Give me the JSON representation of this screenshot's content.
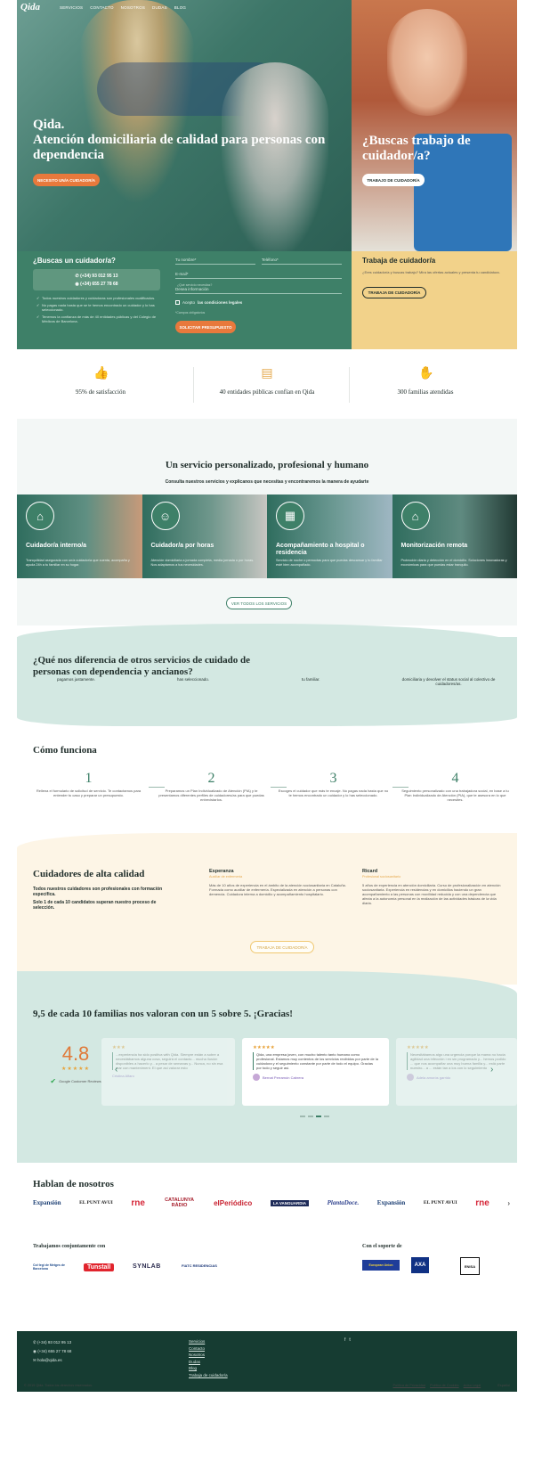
{
  "nav": {
    "logo": "Qida",
    "items": [
      "SERVICIOS",
      "CONTACTO",
      "NOSOTROS",
      "DUDAS",
      "BLOG"
    ]
  },
  "hero": {
    "title_line1": "Qida.",
    "title_line2": "Atención domiciliaria de calidad para personas con dependencia",
    "cta": "NECESITO UN/A CUIDADOR/A",
    "right_title": "¿Buscas trabajo de cuidador/a?",
    "right_cta": "TRABAJO DE CUIDADOR/A"
  },
  "form": {
    "heading": "¿Buscas un cuidador/a?",
    "phone1": "(+34) 93 012 95 13",
    "phone2": "(+34) 655 27 78 68",
    "checks": [
      "Todos nuestros cuidadores y cuidadoras son profesionales cualificados.",
      "No pagas nada hasta que se te hemos encontrado un cuidador y lo has seleccionado.",
      "Tenemos la confianza de más de 40 entidades públicas y del Colegio de Médicos de Barcelona."
    ],
    "name_placeholder": "Tu nombre*",
    "phone_placeholder": "Teléfono*",
    "email_placeholder": "E-mail*",
    "select_label": "¿Qué servicio necesitas?",
    "select_value": "Desea información",
    "accept_prefix": "Acepto",
    "accept_link": "las condiciones legales",
    "required_note": "*Campos obligatorios",
    "submit": "SOLICITAR PRESUPUESTO"
  },
  "job": {
    "heading": "Trabaja de cuidador/a",
    "text": "¿Eres cuidador/a y buscas trabajo? Mira las ofertas actuales y presenta tu candidatura.",
    "cta": "TRABAJA DE CUIDADOR/A"
  },
  "stats": [
    {
      "icon": "thumbs-up-icon",
      "text": "95% de satisfacción"
    },
    {
      "icon": "document-icon",
      "text": "40 entidades públicas confían en Qida"
    },
    {
      "icon": "hands-icon",
      "text": "300 familias atendidas"
    }
  ],
  "services": {
    "title": "Un servicio personalizado, profesional y humano",
    "subtitle": "Consulta nuestros servicios y explicanos que necesitas y encontraremos la manera de ayudarte",
    "cards": [
      {
        "title": "Cuidador/a interno/a",
        "desc": "Tranquilidad asegurada con un/a cuidador/a que cuenta, acompaña y ayuda 24h a tu familiar en su hogar."
      },
      {
        "title": "Cuidador/a por horas",
        "desc": "Atención domiciliaria a jornada completa, media jornada o por horas. Nos adaptamos a tus necesidades."
      },
      {
        "title": "Acompañamiento a hospital o residencia",
        "desc": "Servicio de noche o pernoctas para que puedas descansar y tu familiar esté bien acompañado."
      },
      {
        "title": "Monitorización remota",
        "desc": "Protección diaria y detección en el domicilio. Soluciones innovadoras y económicas para que puedas estar tranquilo."
      }
    ],
    "cta": "VER TODOS LOS SERVICIOS"
  },
  "difference": {
    "title": "¿Qué nos diferencia de otros servicios de cuidado de personas con dependencia y ancianos?",
    "snippets": [
      "pagamos justamente.",
      "has seleccionado.",
      "tu familiar.",
      "domiciliaria y devolver el status social al colectivo de cuidadores/as."
    ]
  },
  "how": {
    "title": "Cómo funciona",
    "steps": [
      {
        "n": "1",
        "text": "Rellena el formulario de solicitud de servicio. Te contactamos para entender tu caso y preparar un presupuesto."
      },
      {
        "n": "2",
        "text": "Preparamos un Plan Individualizado de Atención (PIA) y te presentamos diferentes perfiles de cuidadores/as para que puedas entrevistarlos."
      },
      {
        "n": "3",
        "text": "Escoges el cuidador que más te encaje. No pagas nada hasta que no te hemos encontrado un cuidador y lo has seleccionado."
      },
      {
        "n": "4",
        "text": "Seguimiento personalizado con una trabajadora social, en base a tu Plan Individualizado de Atención (PIA), que te asesora en lo que necesites."
      }
    ]
  },
  "quality": {
    "title": "Cuidadores de alta calidad",
    "desc1": "Todos nuestros cuidadores son profesionales con formación específica.",
    "desc2": "Solo 1 de cada 10 candidatos superan nuestro proceso de selección.",
    "carers": [
      {
        "name": "Esperanza",
        "role": "Auxiliar de enfermería",
        "text": "Más de 10 años de experiencia en el ámbito de la atención sociosanitaria en Cataluña. Formada como auxiliar de enfermería. Especializada en atención a personas con demencia. Cuidadora interna a domicilio y acompañamiento hospitalario."
      },
      {
        "name": "Ricard",
        "role": "Profesional sociosanitario",
        "text": "5 años de experiencia en atención domiciliaria. Curso de profesionalización en atención sociosanitaria. Experiencia en residencias y en domicilios haciendo un gran acompañamiento a las personas con movilidad reducida y con una dependencia que afecta a la autonomía personal en la realización de las actividades básicas de la vida diaria."
      }
    ],
    "cta": "TRABAJA DE CUIDADOR/A"
  },
  "reviews": {
    "title": "9,5 de cada 10 familias nos valoran con un 5 sobre 5. ¡Gracias!",
    "score": "4.8",
    "score_stars": "★★★★★",
    "google_label": "Google Customer Reviews",
    "items": [
      {
        "stars": "★★★",
        "text": "...experiencia ha sido positiva with Qida. Siempre están a sobre a necesitábamos alguna cosa, seguirá el contacto... mucha ilusión disponibles a hacerlo y... a pesar de semanas y... Nunca, no sin esa mar con manteniment. El que así valorar esto",
        "who": "Cristina Alfaro"
      },
      {
        "stars": "★★★★★",
        "text": "Qida, una empresa joven, con mucho talento tanto humano como profesional. Estamos muy contentos de los servicios recibidos por parte de la cuidadora y el seguimiento constante por parte de todo el equipo. Gracias por todo y seguir así.",
        "who": "Bernat Perramón Cabrera"
      },
      {
        "stars": "★★★★★",
        "text": "Necesitábamos algo una urgencia porque la mama no hacia agilidad una infección i en sin programado y... hemos podido ... que nos acompañar una muy buena familia y... está parte nuestro... a ... están tan a los con lo seguimiento",
        "who": "Adela amorós garrido"
      }
    ]
  },
  "press": {
    "title": "Hablan de nosotros",
    "logos": [
      "Expansión",
      "EL PUNT AVUI",
      "rne",
      "CATALUNYA RÀDIO",
      "elPeriódico",
      "LA VANGUARDIA",
      "PlantaDoce.",
      "Expansión",
      "EL PUNT AVUI",
      "rne"
    ]
  },
  "partners": {
    "title": "Trabajamos conjuntamente con",
    "logos": [
      "Col·legi de Metges de Barcelona",
      "Tunstall",
      "SYNLAB",
      "FIATC RESIDENCIAS"
    ],
    "support_title": "Con el soporte de",
    "support_logos": [
      "European Union",
      "AXA",
      "ENISA"
    ]
  },
  "footer": {
    "phone1": "(+34) 93 012 95 13",
    "phone2": "(+34) 655 27 78 68",
    "email": "hola@qida.es",
    "links": [
      "Servicios",
      "Contacto",
      "Nosotros",
      "Dudas",
      "Blog",
      "Trabaja de cuidador/a"
    ],
    "social": [
      "f",
      "t"
    ],
    "copyright": "© 2019 Qida. Todos los derechos reservados.",
    "legal": [
      "Política de Privacidad",
      "Política de Cookies",
      "Aviso Legal"
    ],
    "lang": "Español"
  },
  "colors": {
    "green": "#3e8068",
    "dark_green": "#163c32",
    "orange": "#e8793c",
    "gold": "#f2d28a"
  }
}
